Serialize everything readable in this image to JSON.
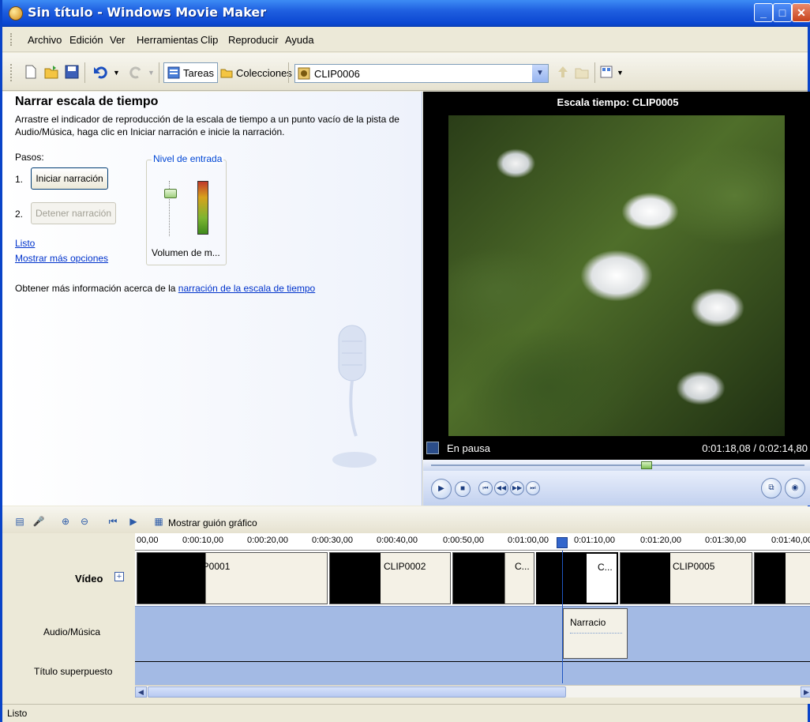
{
  "window": {
    "title": "Sin título - Windows Movie Maker"
  },
  "menu": [
    "Archivo",
    "Edición",
    "Ver",
    "Herramientas",
    "Clip",
    "Reproducir",
    "Ayuda"
  ],
  "toolbar": {
    "tareas_label": "Tareas",
    "colecciones_label": "Colecciones",
    "collection_value": "CLIP0006"
  },
  "taskpane": {
    "title": "Narrar escala de tiempo",
    "description": "Arrastre el indicador de reproducción de la escala de tiempo a un punto vacío de la pista de Audio/Música, haga clic en Iniciar narración e inicie la narración.",
    "steps_label": "Pasos:",
    "step1_num": "1.",
    "step1_button": "Iniciar narración",
    "step2_num": "2.",
    "step2_button": "Detener narración",
    "input_level_legend": "Nivel de entrada",
    "volume_label": "Volumen de m...",
    "done_link": "Listo",
    "more_options_link": "Mostrar más opciones",
    "info_text": "Obtener más información acerca de la",
    "info_link": "narración de la escala de tiempo"
  },
  "preview": {
    "title": "Escala tiempo: CLIP0005",
    "status": "En pausa",
    "time": "0:01:18,08 / 0:02:14,80",
    "seek_fraction": 0.58
  },
  "timeline": {
    "storyboard_label": "Mostrar guión gráfico",
    "ruler_ticks": [
      "00,00",
      "0:00:10,00",
      "0:00:20,00",
      "0:00:30,00",
      "0:00:40,00",
      "0:00:50,00",
      "0:01:00,00",
      "0:01:10,00",
      "0:01:20,00",
      "0:01:30,00",
      "0:01:40,00"
    ],
    "tracks": {
      "video": "Vídeo",
      "audio": "Audio/Música",
      "title_overlay": "Título superpuesto"
    },
    "clips": [
      "CLIP0001",
      "CLIP0002",
      "C...",
      "C...",
      "CLIP0005"
    ],
    "narration_clip": "Narracio"
  },
  "statusbar": {
    "text": "Listo"
  }
}
